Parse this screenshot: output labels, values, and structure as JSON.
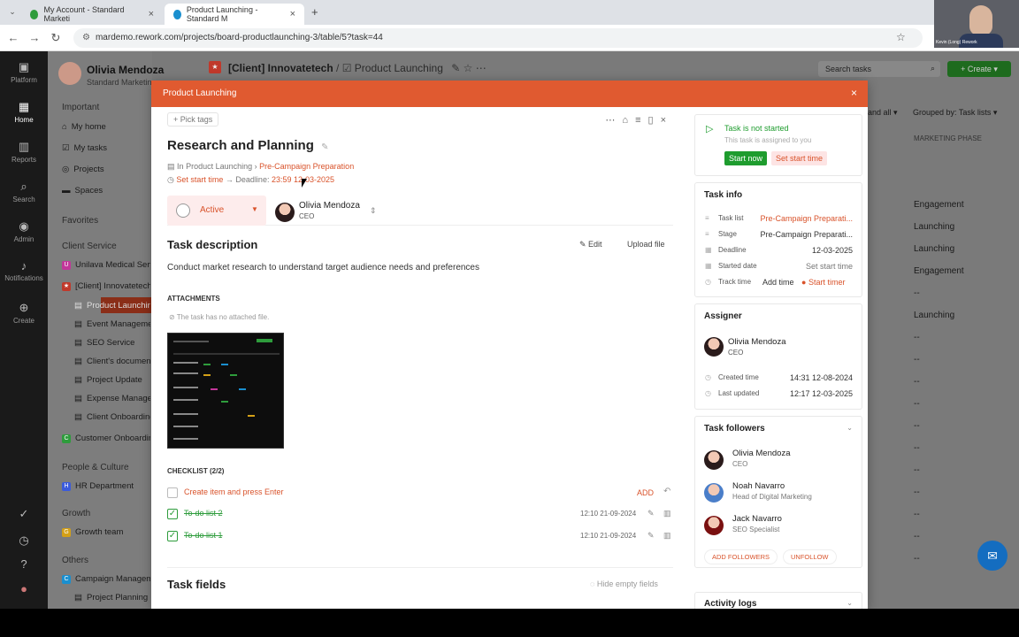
{
  "browser": {
    "tabs": [
      {
        "title": "My Account - Standard Marketi",
        "active": false
      },
      {
        "title": "Product Launching - Standard M",
        "active": true
      }
    ],
    "url": "mardemo.rework.com/projects/board-productlaunching-3/table/5?task=44"
  },
  "rail": {
    "items": [
      "Platform",
      "Home",
      "Reports",
      "Search",
      "Admin",
      "Notifications",
      "Create"
    ]
  },
  "sidebar": {
    "user_name": "Olivia Mendoza",
    "user_role": "Standard Marketing",
    "sections": {
      "important": "Important",
      "favorites": "Favorites",
      "client_service": "Client Service",
      "people_culture": "People & Culture",
      "growth": "Growth",
      "others": "Others"
    },
    "important_items": [
      "My home",
      "My tasks",
      "Projects",
      "Spaces"
    ],
    "client_items": [
      "Unilava Medical Serv",
      "[Client] Innovatetech"
    ],
    "project_items": [
      "Product Launching",
      "Event Management",
      "SEO Service",
      "Client's document",
      "Project Update",
      "Expense Manage",
      "Client Onboarding"
    ],
    "extra_items": [
      "Customer Onboardin"
    ],
    "people_items": [
      "HR Department"
    ],
    "growth_items": [
      "Growth team"
    ],
    "others_items": [
      "Campaign Manageme",
      "Project Planning"
    ]
  },
  "topbar": {
    "breadcrumb_client": "[Client] Innovatetech",
    "breadcrumb_project": "Product Launching",
    "search_placeholder": "Search tasks",
    "create_label": "Create",
    "expand_all": "and all",
    "grouped_by": "Grouped by: Task lists"
  },
  "bg_table": {
    "column": "MARKETING PHASE",
    "cells": [
      "Engagement",
      "Launching",
      "Launching",
      "Engagement",
      "--",
      "Launching",
      "--",
      "--",
      "--",
      "--",
      "--",
      "--",
      "--",
      "--",
      "--",
      "--",
      "--"
    ]
  },
  "modal": {
    "header": "Product Launching",
    "pick_tags": "Pick tags",
    "title": "Research and Planning",
    "in_label": "In",
    "project": "Product Launching",
    "task_list": "Pre-Campaign Preparation",
    "set_start_time": "Set start time",
    "deadline_label": "Deadline:",
    "deadline_value": "23:59 12-03-2025",
    "status": "Active",
    "assignee_name": "Olivia Mendoza",
    "assignee_role": "CEO",
    "description_title": "Task description",
    "edit_label": "Edit",
    "upload_label": "Upload file",
    "description": "Conduct market research to understand target audience needs and preferences",
    "attachments_title": "ATTACHMENTS",
    "attachments_note": "The task has no attached file.",
    "checklist_title": "CHECKLIST (2/2)",
    "new_item_placeholder": "Create item and press Enter",
    "add_label": "ADD",
    "checklist": [
      {
        "text": "To-do list 2",
        "time": "12:10 21-09-2024"
      },
      {
        "text": "To-do list 1",
        "time": "12:10 21-09-2024"
      }
    ],
    "fields_title": "Task fields",
    "hide_empty": "Hide empty fields"
  },
  "status_card": {
    "title": "Task is not started",
    "subtitle": "This task is assigned to you",
    "start_now": "Start now",
    "set_start": "Set start time"
  },
  "task_info": {
    "title": "Task info",
    "rows": [
      {
        "label": "Task list",
        "value": "Pre-Campaign Preparati..."
      },
      {
        "label": "Stage",
        "value": "Pre-Campaign Preparati..."
      },
      {
        "label": "Deadline",
        "value": "12-03-2025"
      },
      {
        "label": "Started date",
        "value": "Set start time"
      },
      {
        "label": "Track time",
        "value": "Add time",
        "value2": "Start timer"
      }
    ]
  },
  "assigner": {
    "title": "Assigner",
    "name": "Olivia Mendoza",
    "role": "CEO",
    "created_label": "Created time",
    "created_value": "14:31 12-08-2024",
    "updated_label": "Last updated",
    "updated_value": "12:17 12-03-2025"
  },
  "followers": {
    "title": "Task followers",
    "people": [
      {
        "name": "Olivia Mendoza",
        "role": "CEO"
      },
      {
        "name": "Noah Navarro",
        "role": "Head of Digital Marketing"
      },
      {
        "name": "Jack Navarro",
        "role": "SEO Specialist"
      }
    ],
    "add_label": "ADD FOLLOWERS",
    "unfollow_label": "UNFOLLOW"
  },
  "activity": {
    "title": "Activity logs"
  },
  "webcam_label": "Kevin (Long) Rework",
  "colors": {
    "accent": "#e05a30",
    "link": "#d9532b",
    "success": "#1e9c2e",
    "chat": "#146dc0"
  }
}
